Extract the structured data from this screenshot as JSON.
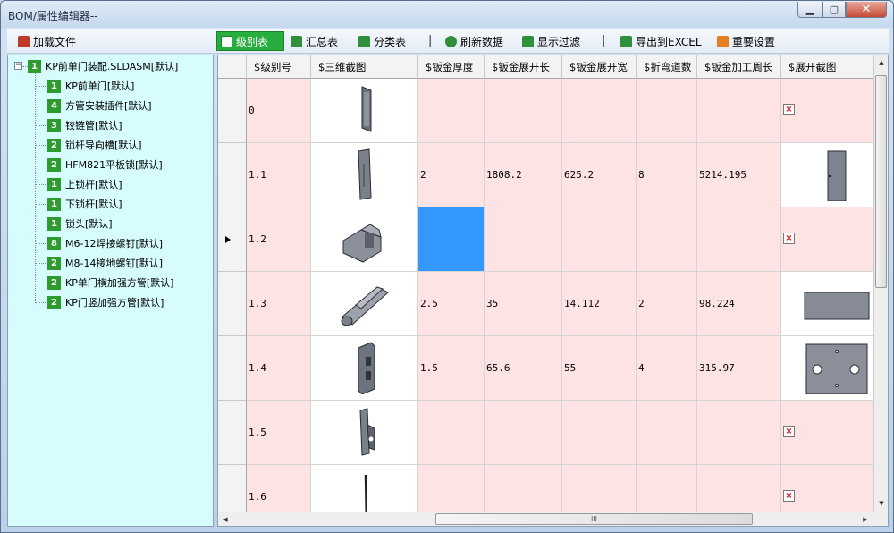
{
  "window": {
    "title": "BOM/属性编辑器--",
    "min_label": "▁",
    "max_label": "▢",
    "close_label": "✕"
  },
  "toolbar": {
    "load": "加载文件",
    "level": "级别表",
    "summary": "汇总表",
    "category": "分类表",
    "refresh": "刷新数据",
    "filter": "显示过滤",
    "export": "导出到EXCEL",
    "settings": "重要设置",
    "separator": "|"
  },
  "tree": {
    "expander": "−",
    "root": {
      "badge": "1",
      "label": "KP前单门装配.SLDASM[默认]"
    },
    "items": [
      {
        "badge": "1",
        "label": "KP前单门[默认]"
      },
      {
        "badge": "4",
        "label": "方管安装插件[默认]"
      },
      {
        "badge": "3",
        "label": "铰链管[默认]"
      },
      {
        "badge": "2",
        "label": "锁杆导向槽[默认]"
      },
      {
        "badge": "2",
        "label": "HFM821平板锁[默认]"
      },
      {
        "badge": "1",
        "label": "上锁杆[默认]"
      },
      {
        "badge": "1",
        "label": "下锁杆[默认]"
      },
      {
        "badge": "1",
        "label": "锁头[默认]"
      },
      {
        "badge": "8",
        "label": "M6-12焊接螺钉[默认]"
      },
      {
        "badge": "2",
        "label": "M8-14接地螺钉[默认]"
      },
      {
        "badge": "2",
        "label": "KP单门横加强方管[默认]"
      },
      {
        "badge": "2",
        "label": "KP门竖加强方管[默认]"
      }
    ]
  },
  "grid": {
    "columns": [
      "$级别号",
      "$三维截图",
      "$钣金厚度",
      "$钣金展开长",
      "$钣金展开宽",
      "$折弯道数",
      "$钣金加工周长",
      "$展开截图"
    ],
    "rows": [
      {
        "level": "0",
        "thickness": "",
        "length": "",
        "width": "",
        "bends": "",
        "perimeter": ""
      },
      {
        "level": "1.1",
        "thickness": "2",
        "length": "1808.2",
        "width": "625.2",
        "bends": "8",
        "perimeter": "5214.195"
      },
      {
        "level": "1.2",
        "thickness": "",
        "length": "",
        "width": "",
        "bends": "",
        "perimeter": ""
      },
      {
        "level": "1.3",
        "thickness": "2.5",
        "length": "35",
        "width": "14.112",
        "bends": "2",
        "perimeter": "98.224"
      },
      {
        "level": "1.4",
        "thickness": "1.5",
        "length": "65.6",
        "width": "55",
        "bends": "4",
        "perimeter": "315.97"
      },
      {
        "level": "1.5",
        "thickness": "",
        "length": "",
        "width": "",
        "bends": "",
        "perimeter": ""
      },
      {
        "level": "1.6",
        "thickness": "",
        "length": "",
        "width": "",
        "bends": "",
        "perimeter": ""
      }
    ],
    "broken_image": "×",
    "scroll_grip": "III"
  },
  "colors": {
    "row_pink": "#fde3e4",
    "selected_cell": "#3399ff",
    "badge_green": "#2e9b2e",
    "tree_bg": "#d6fcfe"
  }
}
